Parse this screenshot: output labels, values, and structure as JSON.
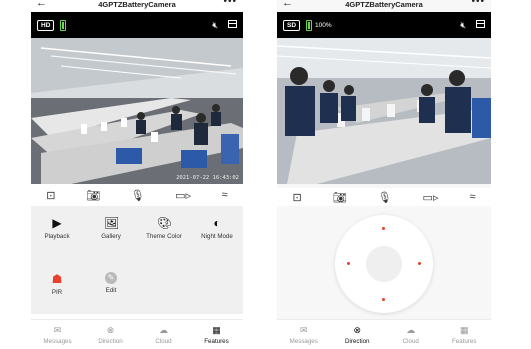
{
  "app": {
    "title": "4GPTZBatteryCamera"
  },
  "colors": {
    "accent": "#e8402c",
    "battery": "#6ad84a",
    "panel_bg": "#f0f0f0"
  },
  "left_screen": {
    "quality": "HD",
    "timestamp": "2021-07-22 16:43:02",
    "features": [
      {
        "label": "Playback",
        "icon": "play-icon"
      },
      {
        "label": "Gallery",
        "icon": "gallery-icon"
      },
      {
        "label": "Theme Color",
        "icon": "palette-icon"
      },
      {
        "label": "Night Mode",
        "icon": "night-mode-icon"
      },
      {
        "label": "PIR",
        "icon": "pir-icon"
      },
      {
        "label": "Edit",
        "icon": "edit-icon"
      }
    ],
    "active_tab": "Features"
  },
  "right_screen": {
    "quality": "SD",
    "battery": "100%",
    "active_tab": "Direction"
  },
  "toolbar": [
    "screen-capture-icon",
    "camera-icon",
    "mic-icon",
    "video-icon",
    "collapse-icon"
  ],
  "tabs": [
    {
      "label": "Messages",
      "icon": "messages-icon"
    },
    {
      "label": "Direction",
      "icon": "direction-icon"
    },
    {
      "label": "Cloud",
      "icon": "cloud-icon"
    },
    {
      "label": "Features",
      "icon": "features-icon"
    }
  ]
}
